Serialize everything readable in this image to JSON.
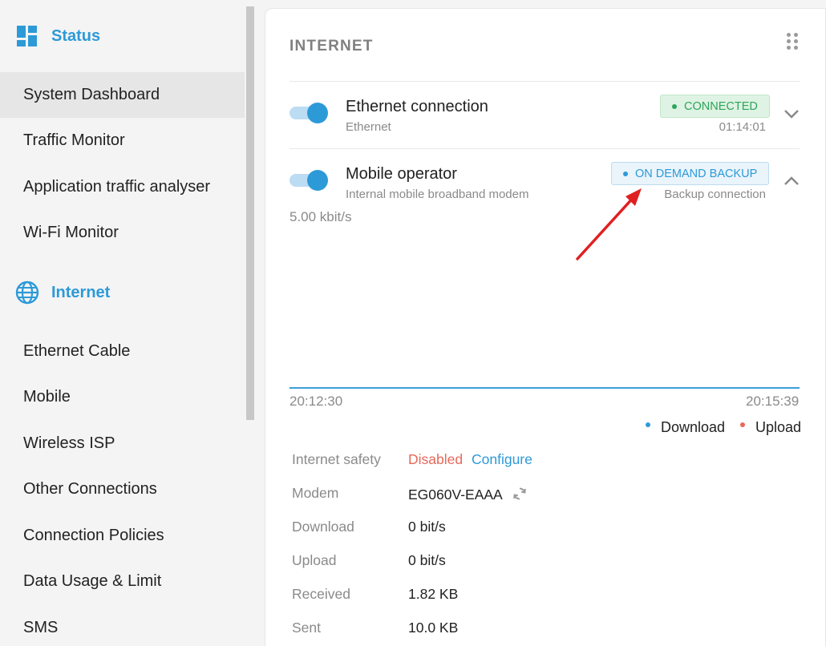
{
  "sidebar": {
    "status_group": {
      "label": "Status",
      "icon": "dashboard-icon"
    },
    "status_items": [
      {
        "label": "System Dashboard",
        "active": true
      },
      {
        "label": "Traffic Monitor"
      },
      {
        "label": "Application traffic analyser"
      },
      {
        "label": "Wi-Fi Monitor"
      }
    ],
    "internet_group": {
      "label": "Internet",
      "icon": "globe-icon"
    },
    "internet_items": [
      {
        "label": "Ethernet Cable"
      },
      {
        "label": "Mobile"
      },
      {
        "label": "Wireless ISP"
      },
      {
        "label": "Other Connections"
      },
      {
        "label": "Connection Policies"
      },
      {
        "label": "Data Usage & Limit"
      },
      {
        "label": "SMS"
      }
    ]
  },
  "card": {
    "title": "INTERNET",
    "connections": [
      {
        "name": "Ethernet connection",
        "type": "Ethernet",
        "status": "CONNECTED",
        "status_color": "#2da55a",
        "right_sub": "01:14:01",
        "enabled": true,
        "expanded": false
      },
      {
        "name": "Mobile operator",
        "type": "Internal mobile broadband modem",
        "status": "ON DEMAND BACKUP",
        "status_color": "#2d9ad8",
        "right_sub": "Backup connection",
        "enabled": true,
        "expanded": true
      }
    ],
    "chart": {
      "rate": "5.00 kbit/s",
      "time_start": "20:12:30",
      "time_end": "20:15:39",
      "legend": [
        {
          "name": "Download",
          "color": "#2d9ad8"
        },
        {
          "name": "Upload",
          "color": "#e8685a"
        }
      ]
    },
    "details": {
      "internet_safety_label": "Internet safety",
      "internet_safety_value": "Disabled",
      "configure_link": "Configure",
      "modem_label": "Modem",
      "modem_value": "EG060V-EAAA",
      "download_label": "Download",
      "download_value": "0 bit/s",
      "upload_label": "Upload",
      "upload_value": "0 bit/s",
      "received_label": "Received",
      "received_value": "1.82 KB",
      "sent_label": "Sent",
      "sent_value": "10.0 KB"
    }
  },
  "colors": {
    "accent": "#2d9ad8",
    "connected": "#2da55a",
    "disabled": "#e8685a",
    "annotation_arrow": "#e02020"
  }
}
